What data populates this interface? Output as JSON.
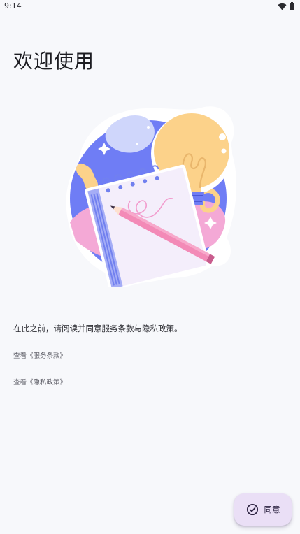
{
  "status_bar": {
    "time": "9:14"
  },
  "page": {
    "title": "欢迎使用"
  },
  "content": {
    "intro": "在此之前，请阅读并同意服务条款与隐私政策。",
    "terms_link": "查看《服务条款》",
    "privacy_link": "查看《隐私政策》"
  },
  "actions": {
    "agree_label": "同意"
  },
  "icons": {
    "wifi": "wifi-icon",
    "battery": "battery-icon",
    "check": "check-circle-icon"
  },
  "colors": {
    "background": "#f7f8fb",
    "fab_background": "#eadff6",
    "accent": "#6e7cf4"
  }
}
